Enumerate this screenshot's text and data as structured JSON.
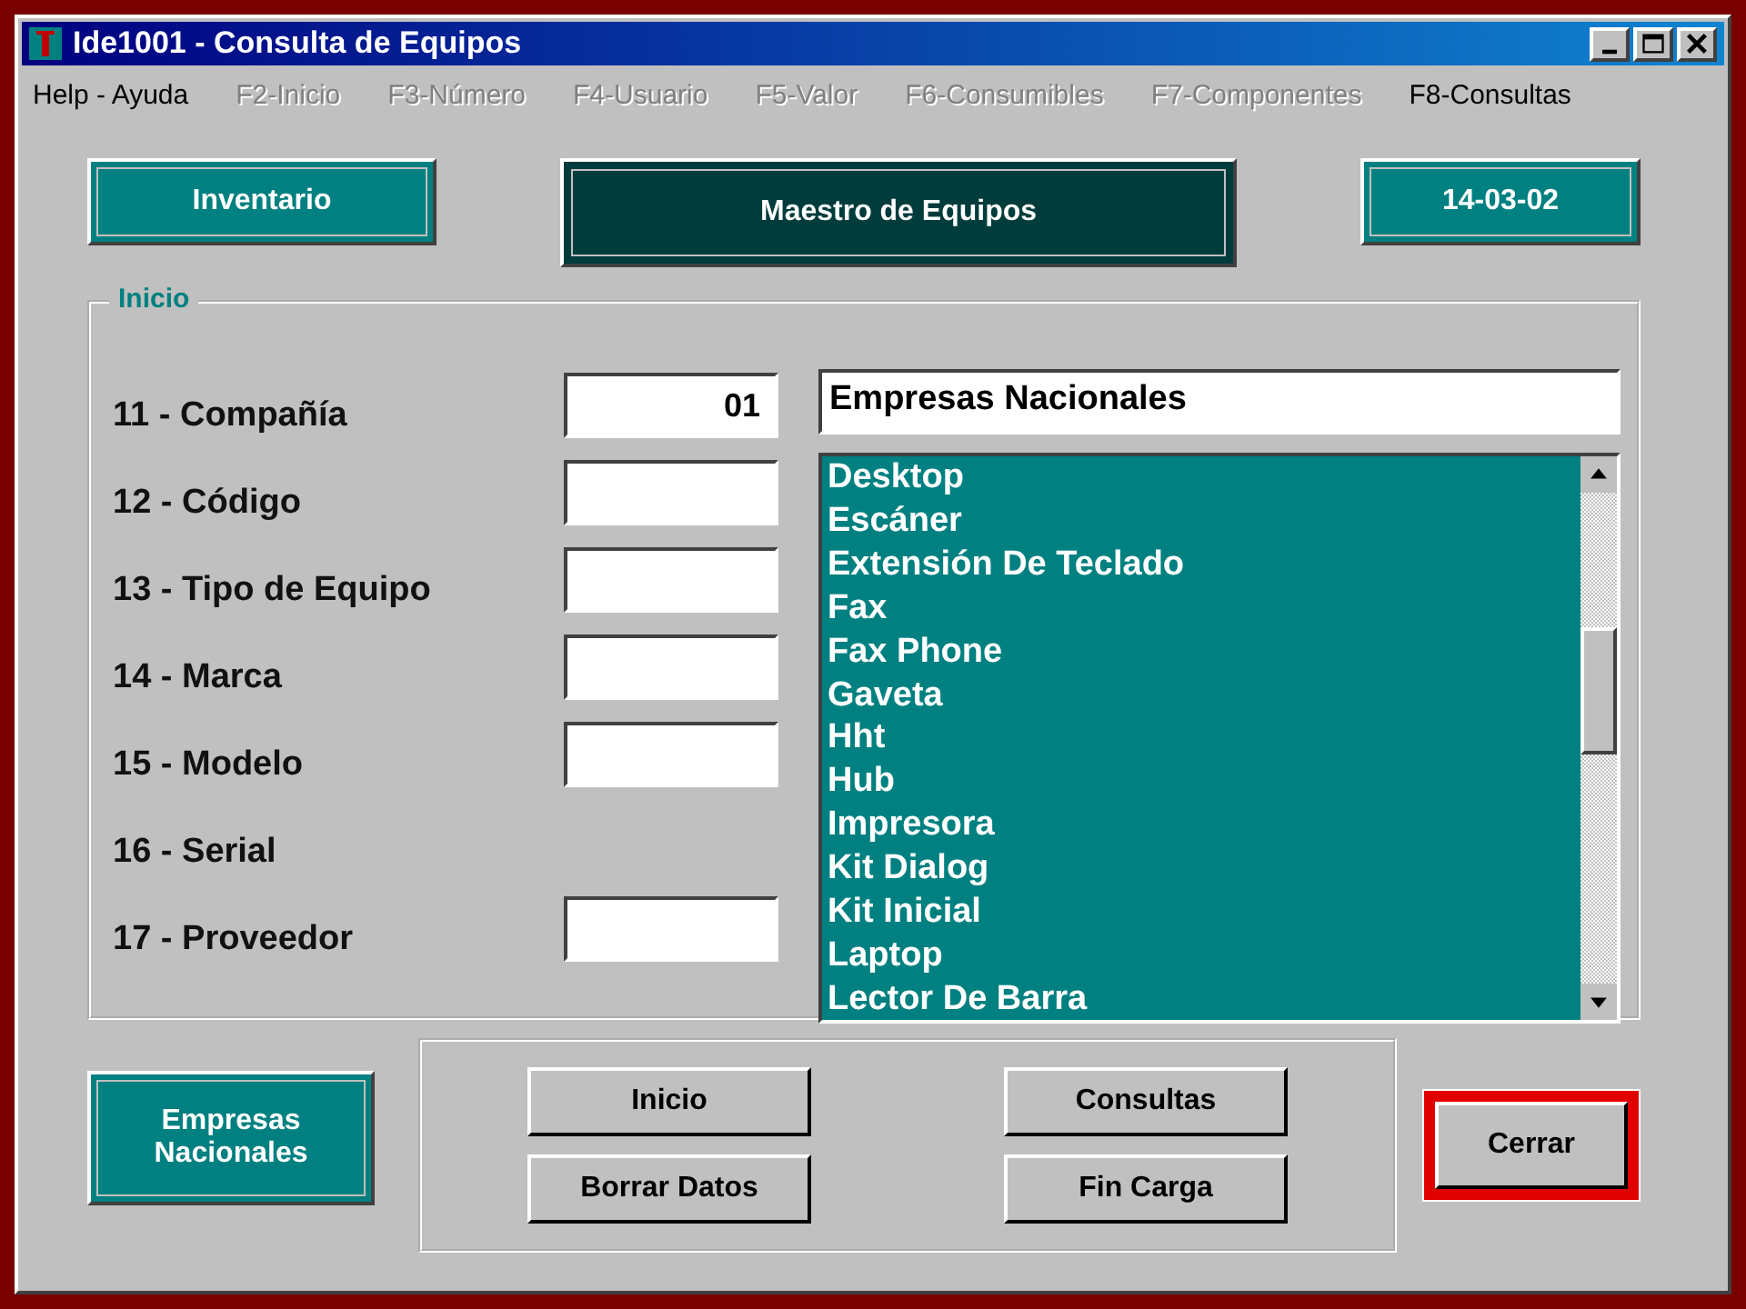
{
  "window": {
    "title": "Ide1001 - Consulta de Equipos"
  },
  "menu": [
    {
      "label": "Help - Ayuda",
      "disabled": false
    },
    {
      "label": "F2-Inicio",
      "disabled": true
    },
    {
      "label": "F3-Número",
      "disabled": true
    },
    {
      "label": "F4-Usuario",
      "disabled": true
    },
    {
      "label": "F5-Valor",
      "disabled": true
    },
    {
      "label": "F6-Consumibles",
      "disabled": true
    },
    {
      "label": "F7-Componentes",
      "disabled": true
    },
    {
      "label": "F8-Consultas",
      "disabled": false
    }
  ],
  "header": {
    "left": "Inventario",
    "center": "Maestro de Equipos",
    "right": "14-03-02"
  },
  "group": {
    "title": "Inicio",
    "fields": [
      {
        "label": "11 - Compañía",
        "kind": "input",
        "value": "01"
      },
      {
        "label": "12 - Código",
        "kind": "input"
      },
      {
        "label": "13 - Tipo de Equipo",
        "kind": "input"
      },
      {
        "label": "14 - Marca",
        "kind": "input"
      },
      {
        "label": "15 - Modelo",
        "kind": "input"
      },
      {
        "label": "16 - Serial",
        "kind": "label"
      },
      {
        "label": "17 - Proveedor",
        "kind": "input"
      }
    ],
    "company_name": "Empresas Nacionales",
    "list": [
      "Desktop",
      "Escáner",
      "Extensión De Teclado",
      "Fax",
      "Fax Phone",
      "Gaveta",
      "Hht",
      "Hub",
      "Impresora",
      "Kit Dialog",
      "Kit Inicial",
      "Laptop",
      "Lector De Barra"
    ]
  },
  "company_badge": "Empresas Nacionales",
  "buttons": [
    "Inicio",
    "Consultas",
    "Borrar Datos",
    "Fin Carga"
  ],
  "close_button": "Cerrar"
}
